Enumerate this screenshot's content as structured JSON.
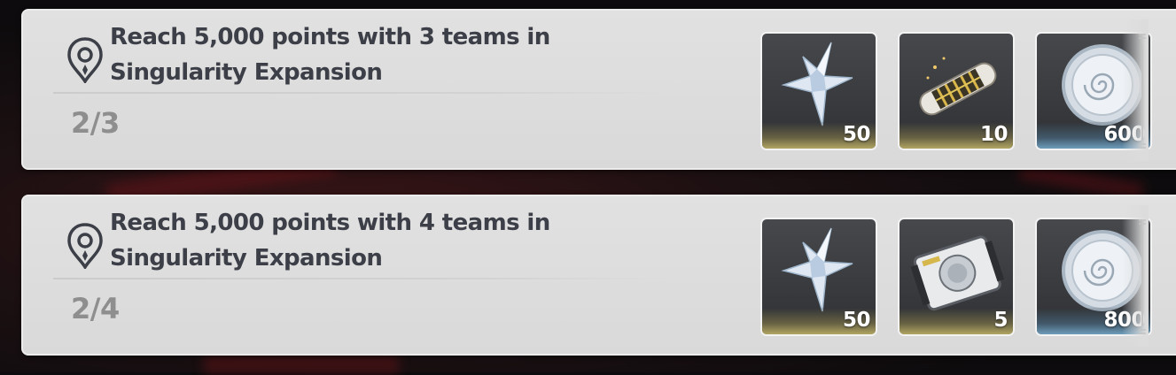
{
  "missions": [
    {
      "title": "Reach 5,000 points with 3 teams in Singularity Expansion",
      "progress": "2/3",
      "rewards": [
        {
          "icon": "crystal-star-icon",
          "quantity": "50",
          "rarity": "gold"
        },
        {
          "icon": "capsule-icon",
          "quantity": "10",
          "rarity": "gold"
        },
        {
          "icon": "coin-icon",
          "quantity": "600",
          "rarity": "blue"
        }
      ]
    },
    {
      "title": "Reach 5,000 points with 4 teams in Singularity Expansion",
      "progress": "2/4",
      "rewards": [
        {
          "icon": "crystal-star-icon",
          "quantity": "50",
          "rarity": "gold"
        },
        {
          "icon": "device-module-icon",
          "quantity": "5",
          "rarity": "gold"
        },
        {
          "icon": "coin-icon",
          "quantity": "800",
          "rarity": "blue"
        }
      ]
    }
  ],
  "colors": {
    "card_bg": "#dcdcdc",
    "title_text": "#3c3f47",
    "progress_text": "#8e8e8e",
    "gold_band": "#d2c36e",
    "blue_band": "#78afd2"
  }
}
